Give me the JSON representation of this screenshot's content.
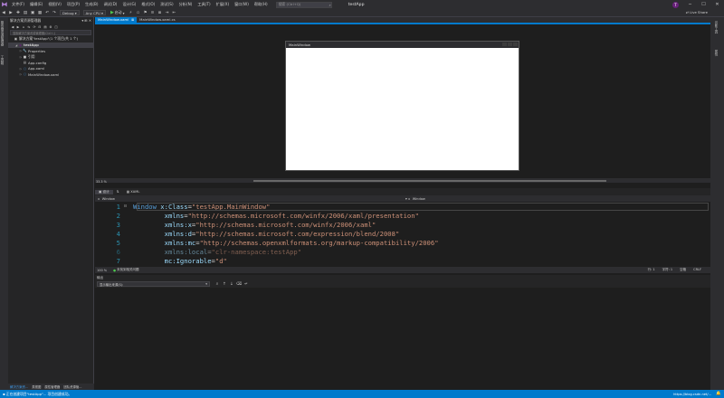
{
  "titlebar": {
    "menu": [
      "文件(F)",
      "编辑(E)",
      "视图(V)",
      "项目(P)",
      "生成(B)",
      "调试(D)",
      "设计(G)",
      "格式(O)",
      "测试(S)",
      "分析(N)",
      "工具(T)",
      "扩展(X)",
      "窗口(W)",
      "帮助(H)"
    ],
    "search_placeholder": "搜索 (Ctrl+Q)",
    "app_title": "testApp",
    "user_initial": "T",
    "live_share": "Live Share"
  },
  "toolbar": {
    "config": "Debug",
    "platform": "Any CPU",
    "run_label": "启动"
  },
  "left_strip": {
    "tabs": [
      "服务器资源管理器",
      "工具箱"
    ]
  },
  "solution_explorer": {
    "title": "解决方案资源管理器",
    "search_placeholder": "搜索解决方案资源管理器(Ctrl+;)",
    "tree": [
      {
        "label": "解决方案\"testApp\"(1 个项目/共 1 个)",
        "icon": "solution-icon",
        "level": 0,
        "caret": ""
      },
      {
        "label": "testApp",
        "icon": "csharp-project-icon",
        "level": 1,
        "caret": "◢",
        "selected": true,
        "bold": true
      },
      {
        "label": "Properties",
        "icon": "wrench-icon",
        "level": 2,
        "caret": "▷"
      },
      {
        "label": "引用",
        "icon": "references-icon",
        "level": 2,
        "caret": "▷"
      },
      {
        "label": "App.config",
        "icon": "config-file-icon",
        "level": 2,
        "caret": ""
      },
      {
        "label": "App.xaml",
        "icon": "xaml-file-icon",
        "level": 2,
        "caret": "▷"
      },
      {
        "label": "MainWindow.xaml",
        "icon": "xaml-file-icon",
        "level": 2,
        "caret": "▷"
      }
    ],
    "bottom_tabs": [
      "解决方案资...",
      "类视图",
      "属性管理器",
      "团队资源管..."
    ]
  },
  "editor": {
    "tabs": [
      {
        "label": "MainWindow.xaml",
        "active": true
      },
      {
        "label": "MainWindow.xaml.cs",
        "active": false
      }
    ]
  },
  "designer": {
    "window_title": "MainWindow",
    "zoom": "33.3 %"
  },
  "split": {
    "tabs": [
      "设计",
      "XAML"
    ],
    "crumb_left": "Window",
    "crumb_right": "Window"
  },
  "code_lines": [
    {
      "n": "1",
      "parts": [
        [
          "tag",
          "Window "
        ],
        [
          "attr",
          "x:Class"
        ],
        [
          "eq",
          "="
        ],
        [
          "str",
          "\"testApp.MainWindow\""
        ]
      ]
    },
    {
      "n": "2",
      "parts": [
        [
          "attr",
          "        xmlns"
        ],
        [
          "eq",
          "="
        ],
        [
          "str",
          "\"http://schemas.microsoft.com/winfx/2006/xaml/presentation\""
        ]
      ]
    },
    {
      "n": "3",
      "parts": [
        [
          "attr",
          "        xmlns:x"
        ],
        [
          "eq",
          "="
        ],
        [
          "str",
          "\"http://schemas.microsoft.com/winfx/2006/xaml\""
        ]
      ]
    },
    {
      "n": "4",
      "parts": [
        [
          "attr",
          "        xmlns:d"
        ],
        [
          "eq",
          "="
        ],
        [
          "str",
          "\"http://schemas.microsoft.com/expression/blend/2008\""
        ]
      ]
    },
    {
      "n": "5",
      "parts": [
        [
          "attr",
          "        xmlns:mc"
        ],
        [
          "eq",
          "="
        ],
        [
          "str",
          "\"http://schemas.openxmlformats.org/markup-compatibility/2006\""
        ]
      ]
    },
    {
      "n": "6",
      "dim": true,
      "parts": [
        [
          "attr",
          "        xmlns:local"
        ],
        [
          "eq",
          "="
        ],
        [
          "str",
          "\"clr-namespace:testApp\""
        ]
      ]
    },
    {
      "n": "7",
      "parts": [
        [
          "attr",
          "        mc:Ignorable"
        ],
        [
          "eq",
          "="
        ],
        [
          "str",
          "\"d\""
        ]
      ]
    }
  ],
  "code_status": {
    "zoom": "100 %",
    "issues": "未找到相关问题",
    "line": "行: 1",
    "char": "字符: 1",
    "spacing": "空格",
    "eol": "CRLF"
  },
  "output": {
    "title": "输出",
    "source_label": "显示输出来源(S):"
  },
  "right_strip": {
    "tabs": [
      "诊断工具",
      "属性"
    ]
  },
  "statusbar": {
    "message": "正在创建项目\"testApp\"... 项目创建成功。",
    "right": "https://blog.csdn.net/..."
  },
  "colors": {
    "accent": "#007acc",
    "background": "#1e1e1e",
    "panel": "#252526",
    "chrome": "#2d2d30"
  }
}
